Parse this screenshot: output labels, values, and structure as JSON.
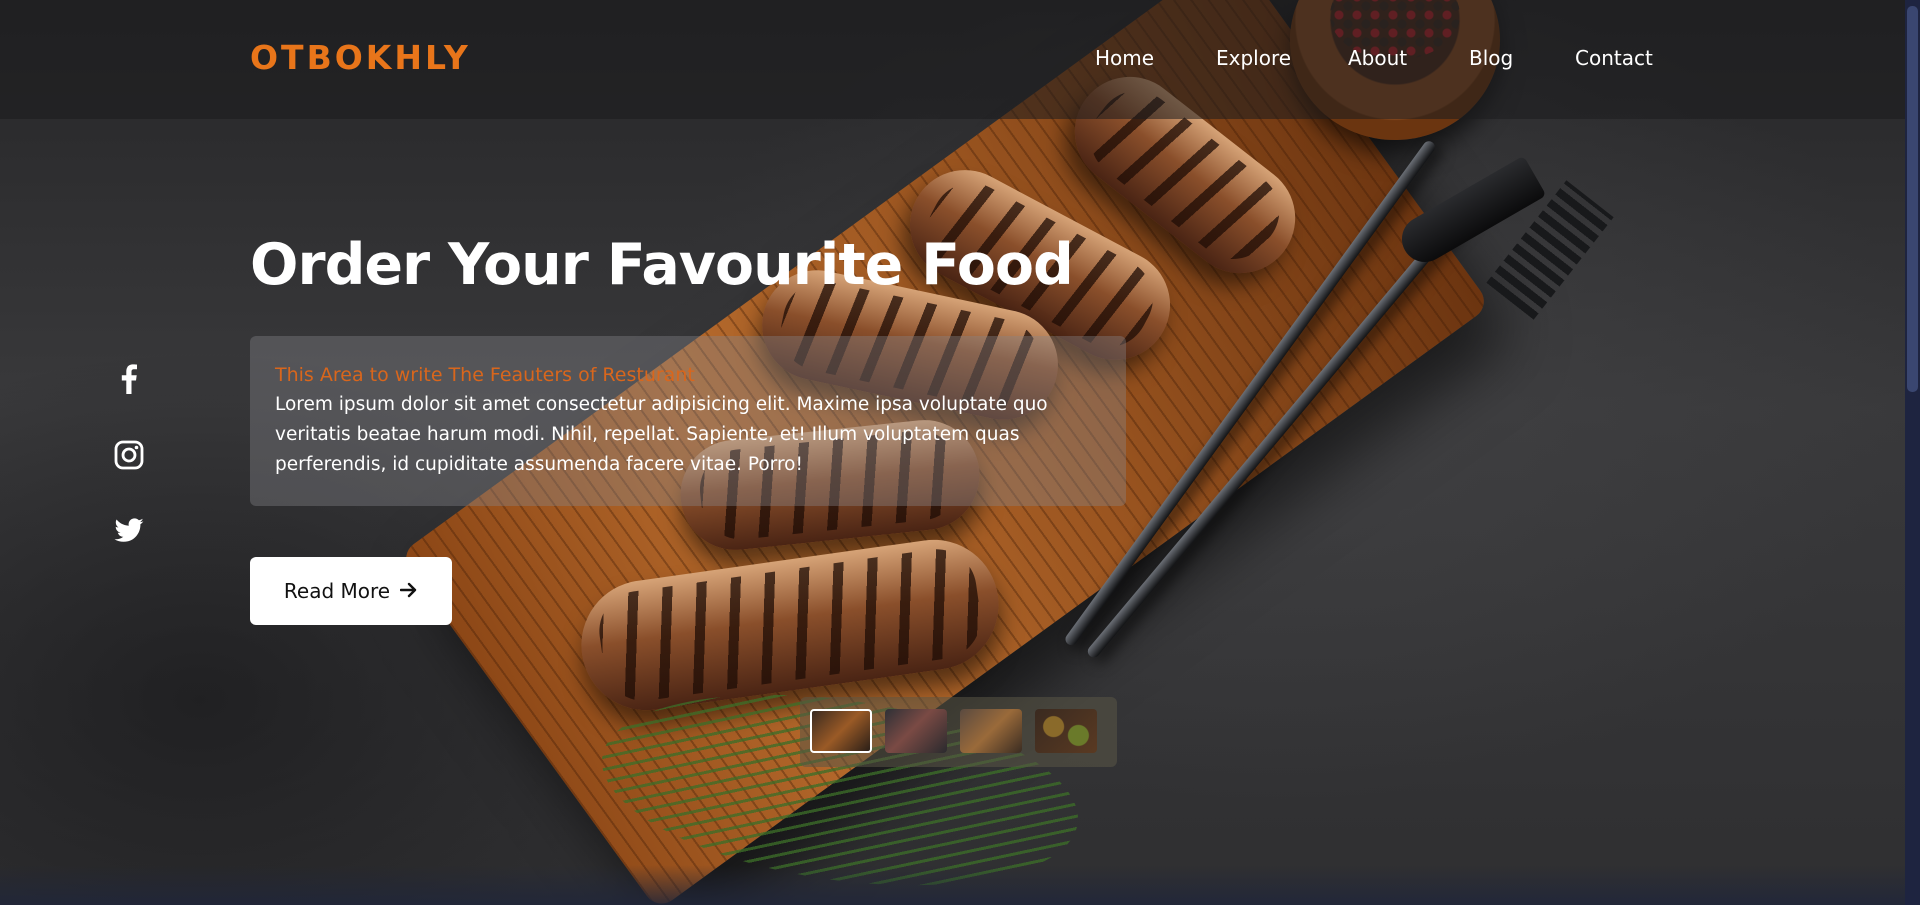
{
  "brand": {
    "logo_text": "OTBOKHLY",
    "accent_color": "#e8751a"
  },
  "nav": {
    "items": [
      {
        "label": "Home"
      },
      {
        "label": "Explore"
      },
      {
        "label": "About"
      },
      {
        "label": "Blog"
      },
      {
        "label": "Contact"
      }
    ]
  },
  "social": {
    "icons": [
      "facebook-icon",
      "instagram-icon",
      "twitter-icon"
    ]
  },
  "hero": {
    "headline": "Order Your Favourite Food",
    "subheading": "This Area to write The Feauters of Resturant",
    "body": "Lorem ipsum dolor sit amet consectetur adipisicing elit. Maxime ipsa voluptate quo veritatis beatae harum modi. Nihil, repellat. Sapiente, et! Illum voluptatem quas perferendis, id cupiditate assumenda facere vitae. Porro!",
    "cta_label": "Read More",
    "cta_icon": "arrow-right-icon"
  },
  "gallery": {
    "thumbnail_count": 4,
    "active_index": 0
  }
}
